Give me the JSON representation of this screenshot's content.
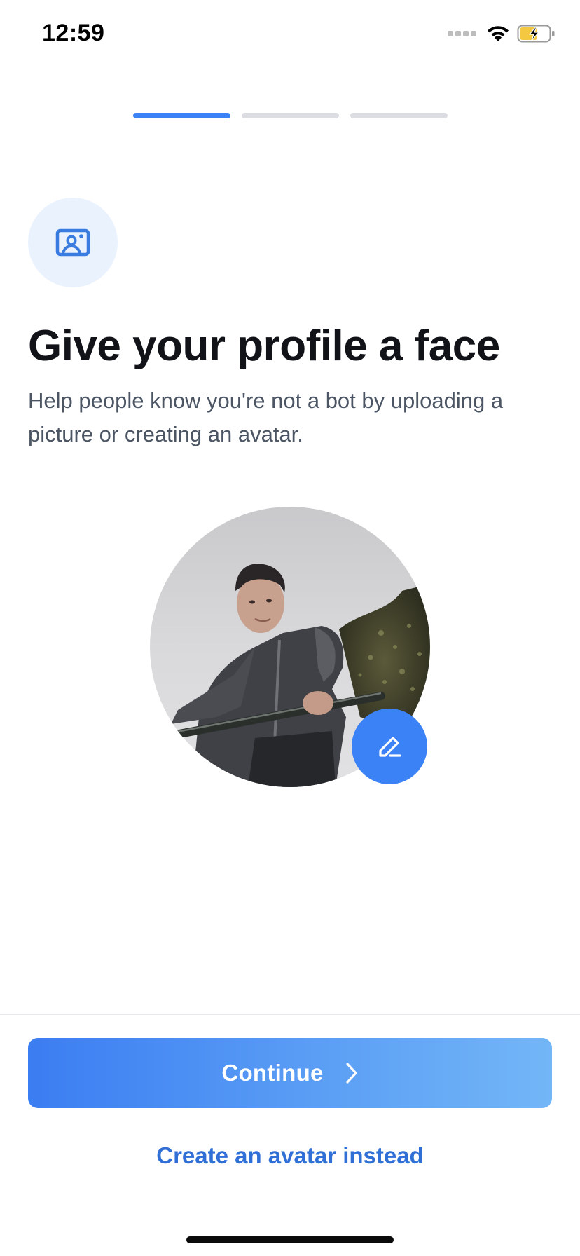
{
  "status_bar": {
    "time": "12:59",
    "icons": [
      "cellular-signal-icon",
      "wifi-icon",
      "battery-charging-icon"
    ]
  },
  "progress": {
    "total_steps": 3,
    "current_step": 1
  },
  "header": {
    "icon": "profile-picture-icon",
    "title": "Give your profile a face",
    "subtitle": "Help people know you're not a bot by uploading a picture or creating an avatar."
  },
  "avatar": {
    "edit_icon": "pencil-icon"
  },
  "actions": {
    "continue_label": "Continue",
    "continue_icon": "chevron-right-icon",
    "alt_label": "Create an avatar instead"
  },
  "colors": {
    "accent": "#3b82f6",
    "link": "#2f6fd6",
    "icon_bubble": "#eaf3fd",
    "progress_inactive": "#dcdde2"
  }
}
